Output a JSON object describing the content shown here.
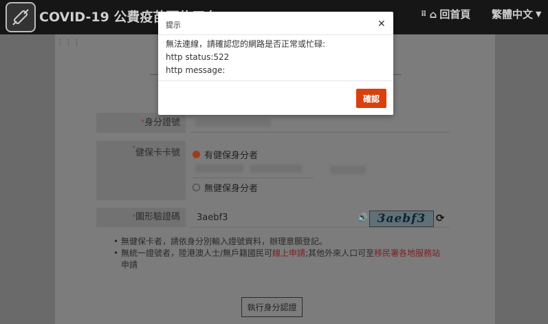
{
  "header": {
    "site_title": "COVID-19 公費疫苗預約平台",
    "home_label": "回首頁",
    "lang_label": "繁體中文"
  },
  "form": {
    "id_label": "身分證號",
    "card_label": "健保卡卡號",
    "has_card_option": "有健保身分者",
    "no_card_option": "無健保身分者",
    "captcha_label": "圖形驗證碼",
    "captcha_value": "3aebf3",
    "captcha_image_text": "3aebf3",
    "verify_button": "執行身分認證"
  },
  "notes": {
    "note1": "無健保卡者，請依身分別輸入證號資料，辦理意願登記。",
    "note2_a": "無統一證號者，陸港澳人士/無戶籍國民可",
    "note2_link1": "線上申請",
    "note2_b": ";其他外來人口可至",
    "note2_link2": "移民署各地服務站",
    "note2_c": "申請"
  },
  "modal": {
    "title": "提示",
    "line1": "無法連線，請確認您的網路是否正常或忙碌:",
    "line2": "http status:522",
    "line3": "http message:",
    "ok_label": "確認"
  },
  "icons": {
    "logo": "syringe-icon",
    "home": "home-icon",
    "grid": "grid-icon",
    "speaker": "speaker-icon",
    "refresh": "refresh-icon",
    "close": "close-icon"
  },
  "colors": {
    "accent": "#d8400e",
    "header_bg": "#161616"
  }
}
